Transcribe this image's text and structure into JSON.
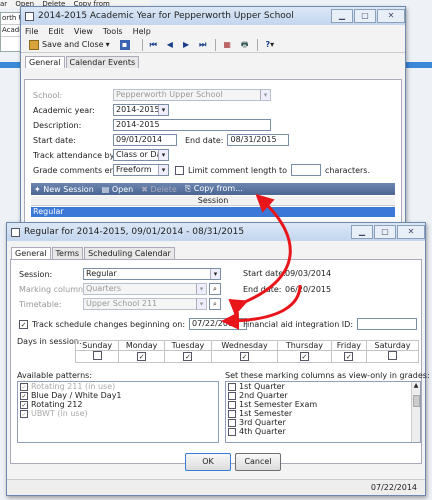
{
  "background_app": {
    "menu": [
      "ar",
      "Open",
      "Delete",
      "Copy from"
    ],
    "left_items": [
      "orth Up",
      "Acade"
    ]
  },
  "academic_year_window": {
    "title": "2014-2015 Academic Year for Pepperworth Upper School",
    "menu": [
      "File",
      "Edit",
      "View",
      "Tools",
      "Help"
    ],
    "toolbar": {
      "save_close": "Save and Close",
      "help": "?"
    },
    "tabs": [
      "General",
      "Calendar Events"
    ],
    "school_label": "School:",
    "school_value": "Pepperworth Upper School",
    "academic_year_label": "Academic year:",
    "academic_year_value": "2014-2015",
    "description_label": "Description:",
    "description_value": "2014-2015",
    "start_date_label": "Start date:",
    "start_date_value": "09/01/2014",
    "end_date_label": "End date:",
    "end_date_value": "08/31/2015",
    "track_attendance_label": "Track attendance by:",
    "track_attendance_value": "Class or Day",
    "grade_comments_label": "Grade comments entry:",
    "grade_comments_value": "Freeform",
    "limit_comment_label": "Limit comment length to",
    "characters_label": "characters.",
    "session_toolbar": {
      "new_session": "New Session",
      "open": "Open",
      "delete": "Delete",
      "copy_from": "Copy from..."
    },
    "session_column": "Session",
    "sessions": [
      "Regular"
    ]
  },
  "session_window": {
    "title": "Regular for 2014-2015, 09/01/2014 - 08/31/2015",
    "tabs": [
      "General",
      "Terms",
      "Scheduling Calendar"
    ],
    "session_label": "Session:",
    "session_value": "Regular",
    "marking_columns_label": "Marking columns:",
    "marking_columns_value": "Quarters",
    "timetable_label": "Timetable:",
    "timetable_value": "Upper School 211",
    "start_date_label": "Start date:",
    "start_date_value": "09/03/2014",
    "end_date_label": "End date:",
    "end_date_value": "06/20/2015",
    "track_schedule_label": "Track schedule changes beginning on:",
    "track_schedule_value": "07/22/2014",
    "financial_aid_label": "Financial aid integration ID:",
    "days_in_session_label": "Days in session:",
    "days": [
      {
        "name": "Sunday",
        "checked": false
      },
      {
        "name": "Monday",
        "checked": true
      },
      {
        "name": "Tuesday",
        "checked": true
      },
      {
        "name": "Wednesday",
        "checked": true
      },
      {
        "name": "Thursday",
        "checked": true
      },
      {
        "name": "Friday",
        "checked": true
      },
      {
        "name": "Saturday",
        "checked": false
      }
    ],
    "available_patterns_label": "Available patterns:",
    "patterns": [
      {
        "label": "Rotating 211 (in use)",
        "checked": true,
        "disabled": true
      },
      {
        "label": "Blue Day / White Day1",
        "checked": true,
        "disabled": false
      },
      {
        "label": "Rotating 212",
        "checked": true,
        "disabled": false
      },
      {
        "label": "UBWT (in use)",
        "checked": true,
        "disabled": true
      }
    ],
    "marking_view_only_label": "Set these marking columns as view-only in grades:",
    "marking_columns_list": [
      "1st Quarter",
      "2nd Quarter",
      "1st Semester Exam",
      "1st Semester",
      "3rd Quarter",
      "4th Quarter"
    ],
    "ok_label": "OK",
    "cancel_label": "Cancel",
    "status_date": "07/22/2014"
  },
  "annotation_color": "#e8161b"
}
